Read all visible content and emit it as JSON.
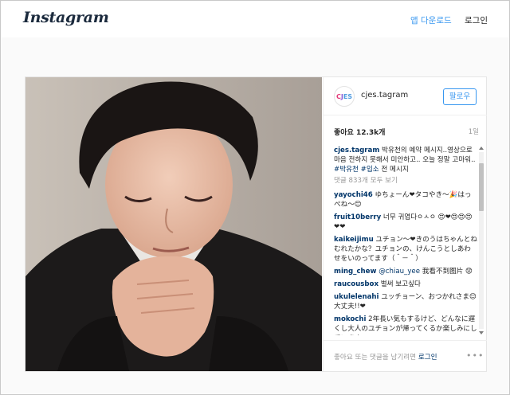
{
  "header": {
    "logo_text": "Instagram",
    "app_download": "앱 다운로드",
    "login": "로그인"
  },
  "post": {
    "avatar_letters": [
      "C",
      "J",
      "ES"
    ],
    "username": "cjes.tagram",
    "follow_label": "팔로우",
    "likes": "좋아요 12.3k개",
    "time_ago": "1일",
    "caption": {
      "user": "cjes.tagram",
      "text": "박유천의 예약 메시지..영상으로 마음 전하지 못해서 미안하고.. 오늘 정말 고마워..",
      "tag1": "#박유천",
      "tag2": "#입소",
      "tail": "전 메시지"
    },
    "view_all": "댓글 833개 모두 보기",
    "comments": [
      {
        "user": "yayochi46",
        "text": "ゆちょーん❤タコやき～🎉はっぺね～😊"
      },
      {
        "user": "fruit10berry",
        "text": "너무 귀엽다ㅇㅅㅇ 😍❤😍😍😍❤❤"
      },
      {
        "user": "kaikeijimu",
        "text": "ユチョン～❤きのうはちゃんとねむれたかな？ユチョンの、けんこうとしあわせをいのってます（＾－＾）"
      },
      {
        "user": "ming_chew",
        "mention": "@chiau_yee",
        "text": "我看不到图片 😟"
      },
      {
        "user": "raucousbox",
        "text": "벌써 보고싶다"
      },
      {
        "user": "ukulelenahi",
        "text": "ユッチョーン、おつかれさま😊大丈夫!!❤"
      },
      {
        "user": "mokochi",
        "text": "2年長い気もするけど、どんなに遅くし大人のユチョンが帰ってくるか楽しみにしています"
      }
    ],
    "footer_text": "좋아요 또는 댓글을 남기려면",
    "footer_login": "로그인",
    "more_icon": "more-horizontal-icon"
  }
}
